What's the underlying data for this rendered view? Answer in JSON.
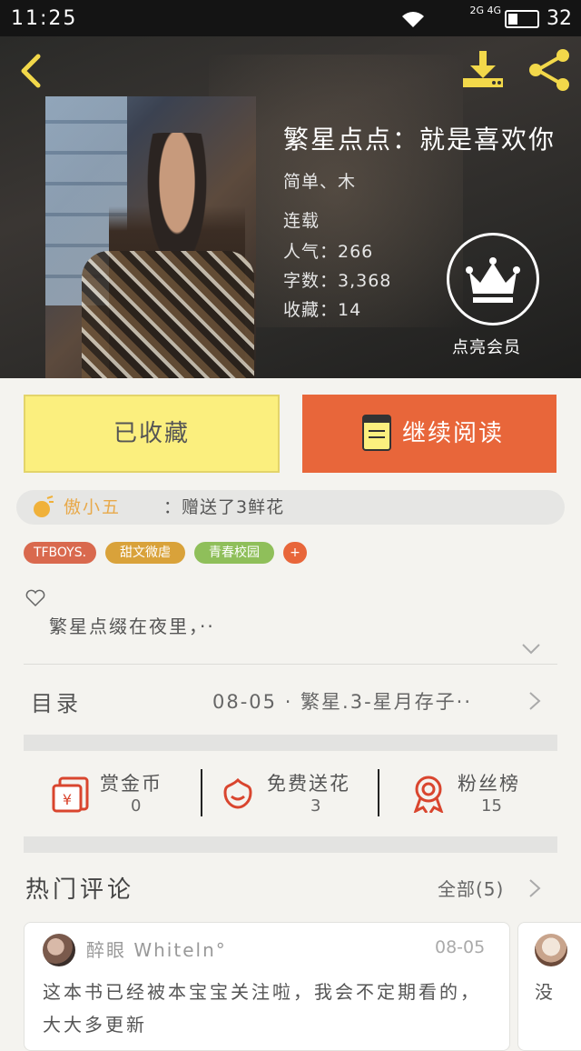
{
  "status_bar": {
    "time": "11:25",
    "network": "2G 4G",
    "battery": "32"
  },
  "book": {
    "title": "繁星点点：就是喜欢你",
    "author": "简单、木",
    "status": "连载",
    "popularity": "人气：266",
    "word_count": "字数：3,368",
    "favorites": "收藏：14"
  },
  "vip": {
    "label": "点亮会员"
  },
  "actions": {
    "favorited_label": "已收藏",
    "continue_label": "继续阅读"
  },
  "gift": {
    "user": "傲小五",
    "message": "：赠送了3鲜花"
  },
  "tags": [
    {
      "label": "TFBOYS.",
      "color": "#d9694e"
    },
    {
      "label": "甜文微虐",
      "color": "#d9a23a"
    },
    {
      "label": "青春校园",
      "color": "#8fbf5a"
    },
    {
      "label": "+",
      "color": "#e8663a"
    }
  ],
  "description": "繁星点缀在夜里，··",
  "toc": {
    "label": "目录",
    "latest": "08-05 · 繁星.3-星月存子··"
  },
  "stats": [
    {
      "label": "赏金币",
      "value": "0"
    },
    {
      "label": "免费送花",
      "value": "3"
    },
    {
      "label": "粉丝榜",
      "value": "15"
    }
  ],
  "hot_comments": {
    "title": "热门评论",
    "all_label": "全部(5)",
    "items": [
      {
        "user": "醉眼 Whiteln°",
        "date": "08-05",
        "text": "这本书已经被本宝宝关注啦，我会不定期看的，大大多更新"
      },
      {
        "user": "",
        "date": "",
        "text": "没"
      }
    ]
  },
  "colors": {
    "accent": "#e8663a",
    "favorite_bg": "#fbef7e",
    "gift_user": "#e8a94a",
    "icon_red": "#d9452e"
  }
}
